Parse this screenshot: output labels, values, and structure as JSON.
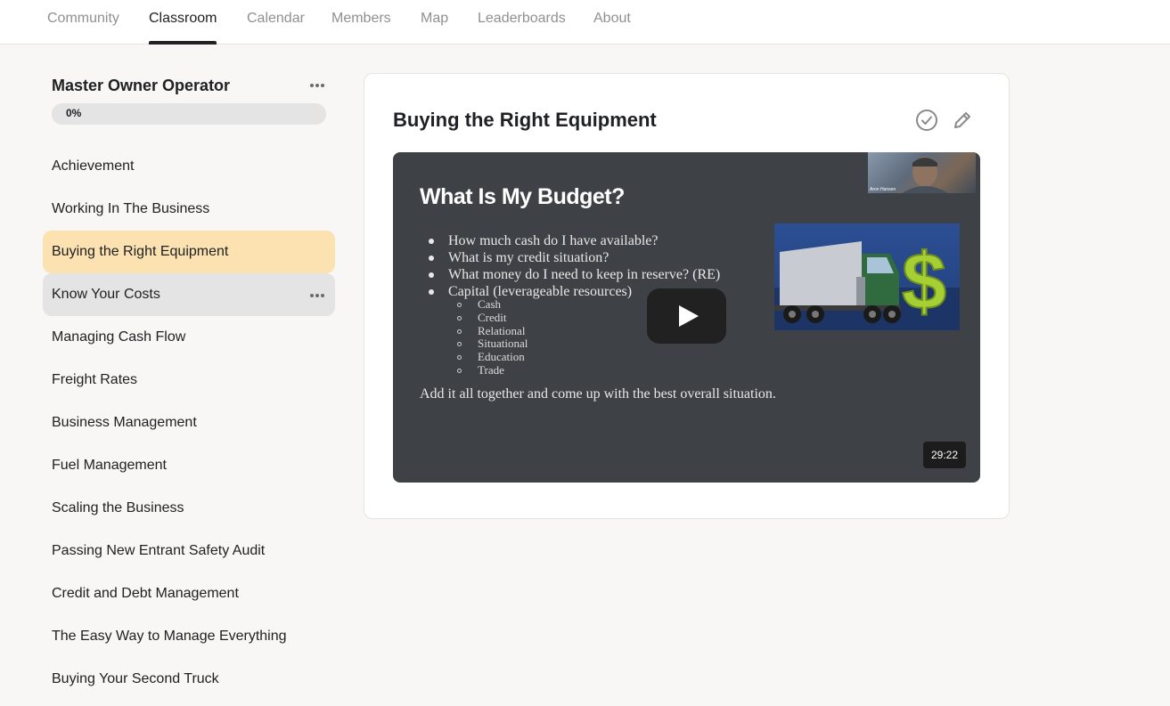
{
  "nav": {
    "tabs": [
      {
        "label": "Community"
      },
      {
        "label": "Classroom",
        "active": true
      },
      {
        "label": "Calendar"
      },
      {
        "label": "Members"
      },
      {
        "label": "Map"
      },
      {
        "label": "Leaderboards"
      },
      {
        "label": "About"
      }
    ]
  },
  "course": {
    "title": "Master Owner Operator",
    "progress_label": "0%",
    "progress_value": 0,
    "lessons": [
      {
        "label": "Achievement"
      },
      {
        "label": "Working In The Business"
      },
      {
        "label": "Buying the Right Equipment",
        "selected": true
      },
      {
        "label": "Know Your Costs",
        "hovered": true
      },
      {
        "label": "Managing Cash Flow"
      },
      {
        "label": "Freight Rates"
      },
      {
        "label": "Business Management"
      },
      {
        "label": "Fuel Management"
      },
      {
        "label": "Scaling the Business"
      },
      {
        "label": "Passing New Entrant Safety Audit"
      },
      {
        "label": "Credit and Debt Management"
      },
      {
        "label": "The Easy Way to Manage Everything"
      },
      {
        "label": "Buying Your Second Truck"
      }
    ]
  },
  "lesson": {
    "title": "Buying the Right Equipment",
    "complete_icon": "check-circle-icon",
    "edit_icon": "pencil-icon",
    "video": {
      "slide_title": "What Is My Budget?",
      "bullets": [
        "How much cash do I have available?",
        "What is my credit situation?",
        "What money do I need to keep in reserve?  (RE)",
        "Capital (leverageable resources)"
      ],
      "sub_bullets": [
        "Cash",
        "Credit",
        "Relational",
        "Situational",
        "Education",
        "Trade"
      ],
      "summary": "Add it all together and come up with the best overall situation.",
      "presenter_name": "Aron Hansen",
      "duration": "29:22"
    }
  },
  "colors": {
    "selected_bg": "#fbe2b0",
    "hover_bg": "#e4e4e4",
    "video_bg": "#3e4246"
  }
}
